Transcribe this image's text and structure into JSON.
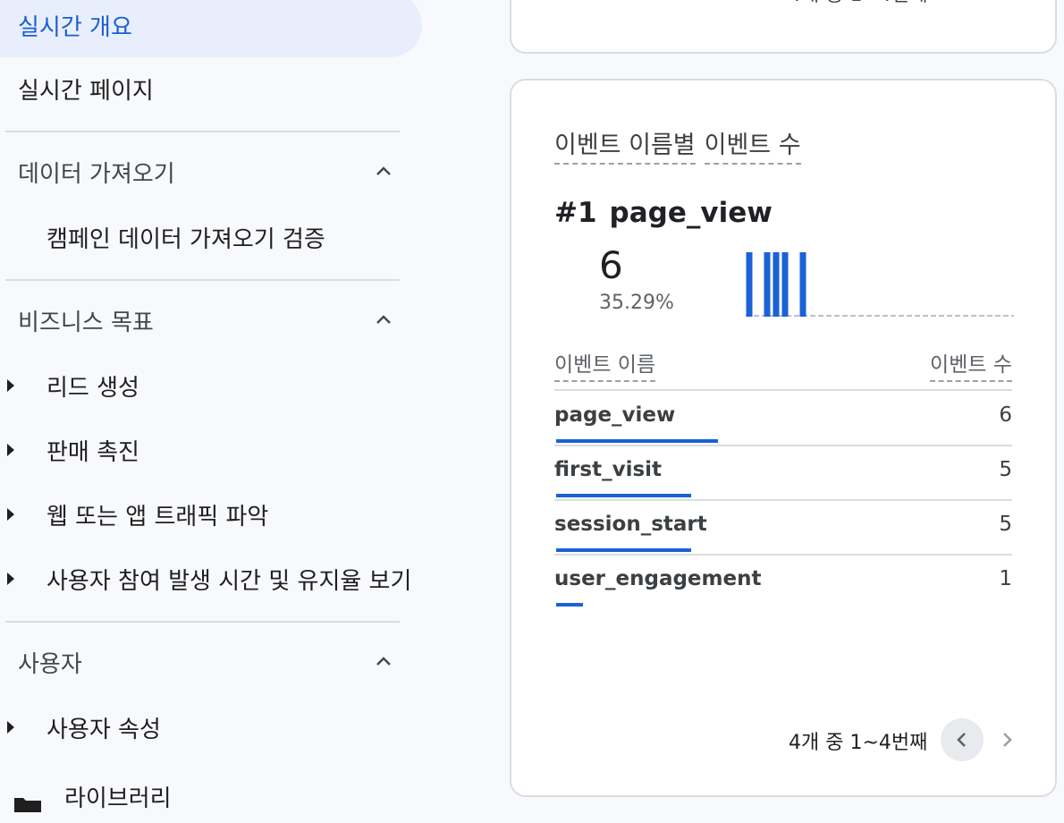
{
  "sidebar": {
    "active_item": "실시간 개요",
    "realtime_pages": "실시간 페이지",
    "sections": [
      {
        "title": "데이터 가져오기",
        "items": [
          "캠페인 데이터 가져오기 검증"
        ]
      },
      {
        "title": "비즈니스 목표",
        "items": [
          "리드 생성",
          "판매 촉진",
          "웹 또는 앱 트래픽 파악",
          "사용자 참여 발생 시간 및 유지율 보기"
        ]
      },
      {
        "title": "사용자",
        "items": [
          "사용자 속성"
        ]
      }
    ],
    "partial_item": "라이브러리"
  },
  "card": {
    "title_part1": "이벤트 이름별",
    "title_part2": "이벤트 수",
    "rank": "#1",
    "top_event": "page_view",
    "top_value": "6",
    "top_percent": "35.29%",
    "col_name": "이벤트 이름",
    "col_count": "이벤트 수",
    "rows": [
      {
        "name": "page_view",
        "count": "6",
        "share": 0.353
      },
      {
        "name": "first_visit",
        "count": "5",
        "share": 0.294
      },
      {
        "name": "session_start",
        "count": "5",
        "share": 0.294
      },
      {
        "name": "user_engagement",
        "count": "1",
        "share": 0.059
      }
    ],
    "pager_text": "4개 중 1~4번째",
    "sparkline": [
      1,
      0,
      1,
      1,
      1,
      0,
      1,
      0,
      0,
      0,
      0,
      0,
      0,
      0,
      0,
      0,
      0,
      0,
      0,
      0,
      0,
      0,
      0,
      0,
      0,
      0,
      0,
      0,
      0,
      0
    ]
  },
  "top_card": {
    "pager_text": "4개 중 1~4번째"
  },
  "colors": {
    "accent": "#1a62d6",
    "active_bg": "#e8eefb"
  }
}
